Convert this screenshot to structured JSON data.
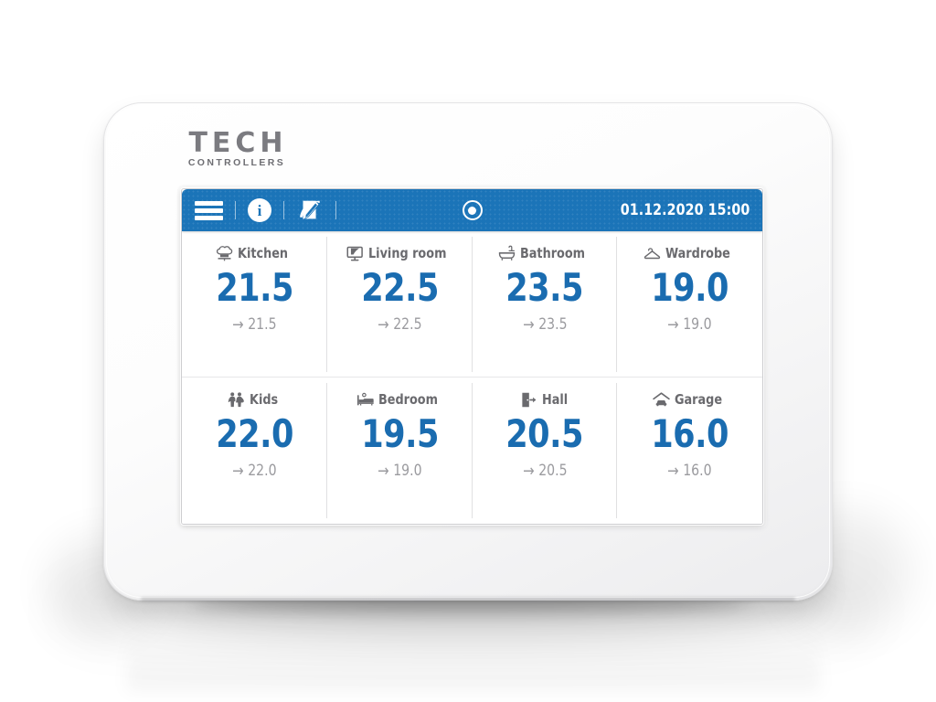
{
  "brand": {
    "name": "TECH",
    "tagline": "CONTROLLERS"
  },
  "colors": {
    "header_blue": "#1b74b8",
    "temperature_blue": "#1a6cb0",
    "label_gray": "#6a6a6e",
    "setpoint_gray": "#9b9b9f",
    "divider": "#e0e0e2",
    "screen_bg": "#ffffff",
    "bezel": "#f4f4f5"
  },
  "topbar": {
    "menu_icon": "hamburger-menu-icon",
    "info_icon": "info-circle-icon",
    "info_glyph": "i",
    "edit_icon": "pen-edit-icon",
    "status_icon": "record-target-icon",
    "datetime": "01.12.2020 15:00",
    "date": "01.12.2020",
    "time": "15:00"
  },
  "rooms": [
    {
      "name": "Kitchen",
      "icon": "chef-hat-icon",
      "current_temperature": "21.5",
      "setpoint": "21.5",
      "arrow": "→"
    },
    {
      "name": "Living room",
      "icon": "television-icon",
      "current_temperature": "22.5",
      "setpoint": "22.5",
      "arrow": "→"
    },
    {
      "name": "Bathroom",
      "icon": "bathtub-icon",
      "current_temperature": "23.5",
      "setpoint": "23.5",
      "arrow": "→"
    },
    {
      "name": "Wardrobe",
      "icon": "clothes-hanger-icon",
      "current_temperature": "19.0",
      "setpoint": "19.0",
      "arrow": "→"
    },
    {
      "name": "Kids",
      "icon": "children-icon",
      "current_temperature": "22.0",
      "setpoint": "22.0",
      "arrow": "→"
    },
    {
      "name": "Bedroom",
      "icon": "bed-icon",
      "current_temperature": "19.5",
      "setpoint": "19.0",
      "arrow": "→"
    },
    {
      "name": "Hall",
      "icon": "door-exit-icon",
      "current_temperature": "20.5",
      "setpoint": "20.5",
      "arrow": "→"
    },
    {
      "name": "Garage",
      "icon": "garage-car-icon",
      "current_temperature": "16.0",
      "setpoint": "16.0",
      "arrow": "→"
    }
  ]
}
